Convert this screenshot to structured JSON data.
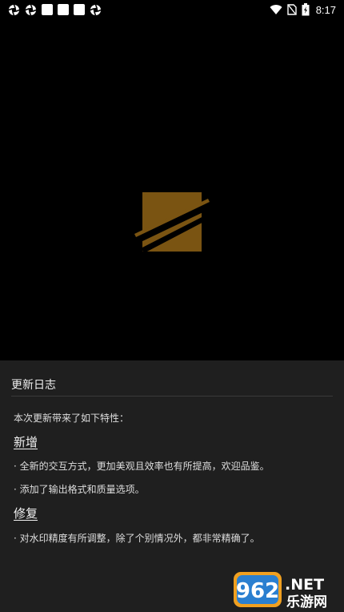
{
  "status_bar": {
    "time": "8:17",
    "icons": [
      "app-notification-icon",
      "app-notification-icon",
      "square-notification-icon",
      "square-notification-icon",
      "square-notification-icon",
      "app-notification-icon",
      "wifi-icon",
      "no-sim-icon",
      "battery-charging-icon"
    ]
  },
  "dialog": {
    "title": "更新日志",
    "intro": "本次更新带来了如下特性：",
    "sections": [
      {
        "heading": "新增",
        "items": [
          "· 全新的交互方式，更加美观且效率也有所提高，欢迎品鉴。",
          "· 添加了输出格式和质量选项。"
        ]
      },
      {
        "heading": "修复",
        "items": [
          "· 对水印精度有所调整，除了个别情况外，都非常精确了。"
        ]
      }
    ]
  },
  "watermark": {
    "number": "962",
    "suffix": ".NET",
    "site": "乐游网"
  },
  "colors": {
    "logo": "#7a5412",
    "sheet": "#1f1f1f",
    "background": "#000000"
  }
}
